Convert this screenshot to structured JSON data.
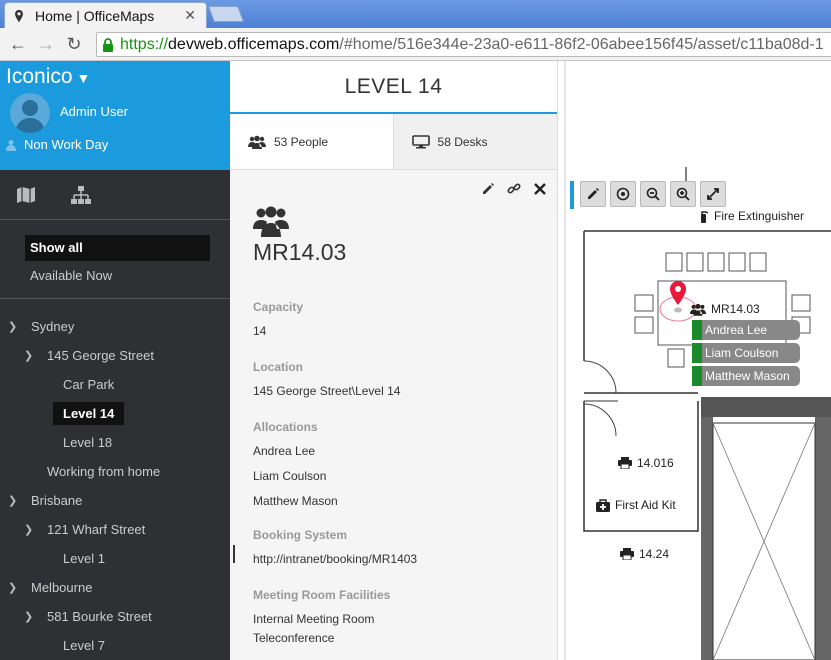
{
  "browser": {
    "tab_title": "Home | OfficeMaps",
    "url_scheme": "https://",
    "url_host": "devweb.officemaps.com",
    "url_path": "/#home/516e344e-23a0-e611-86f2-06abee156f45/asset/c11ba08d-1"
  },
  "sidebar": {
    "brand": "Iconico",
    "user_name": "Admin User",
    "work_status": "Non Work Day",
    "filters": [
      {
        "label": "Show all",
        "active": true
      },
      {
        "label": "Available Now",
        "active": false
      }
    ],
    "tree": [
      {
        "label": "Sydney",
        "level": 0,
        "expanded": true
      },
      {
        "label": "145 George Street",
        "level": 1,
        "expanded": true
      },
      {
        "label": "Car Park",
        "level": 2
      },
      {
        "label": "Level 14",
        "level": 2,
        "selected": true
      },
      {
        "label": "Level 18",
        "level": 2
      },
      {
        "label": "Working from home",
        "level": 1
      },
      {
        "label": "Brisbane",
        "level": 0,
        "expanded": true
      },
      {
        "label": "121 Wharf Street",
        "level": 1,
        "expanded": true
      },
      {
        "label": "Level 1",
        "level": 2
      },
      {
        "label": "Melbourne",
        "level": 0,
        "expanded": true
      },
      {
        "label": "581 Bourke Street",
        "level": 1,
        "expanded": true
      },
      {
        "label": "Level 7",
        "level": 2
      }
    ]
  },
  "details": {
    "level_title": "LEVEL 14",
    "tabs": [
      {
        "label": "53 People",
        "icon": "people-icon"
      },
      {
        "label": "58 Desks",
        "icon": "desk-icon"
      }
    ],
    "room_name": "MR14.03",
    "capacity_label": "Capacity",
    "capacity_value": "14",
    "location_label": "Location",
    "location_value": "145 George Street\\Level 14",
    "allocations_label": "Allocations",
    "allocations": [
      "Andrea Lee",
      "Liam Coulson",
      "Matthew Mason"
    ],
    "booking_label": "Booking System",
    "booking_value": "http://intranet/booking/MR1403",
    "facilities_label": "Meeting Room Facilities",
    "facilities": [
      "Internal Meeting Room",
      "Teleconference"
    ]
  },
  "map": {
    "fire_extinguisher": "Fire Extinguisher",
    "room_label": "MR14.03",
    "occupants": [
      "Andrea Lee",
      "Liam Coulson",
      "Matthew Mason"
    ],
    "printer_1": "14.016",
    "first_aid": "First Aid Kit",
    "printer_2": "14.24",
    "occupant_color": "#1a8a2a",
    "marker_color": "#e8183d"
  },
  "colors": {
    "accent": "#1b9bde",
    "sidebar_bg": "#2f3033"
  }
}
